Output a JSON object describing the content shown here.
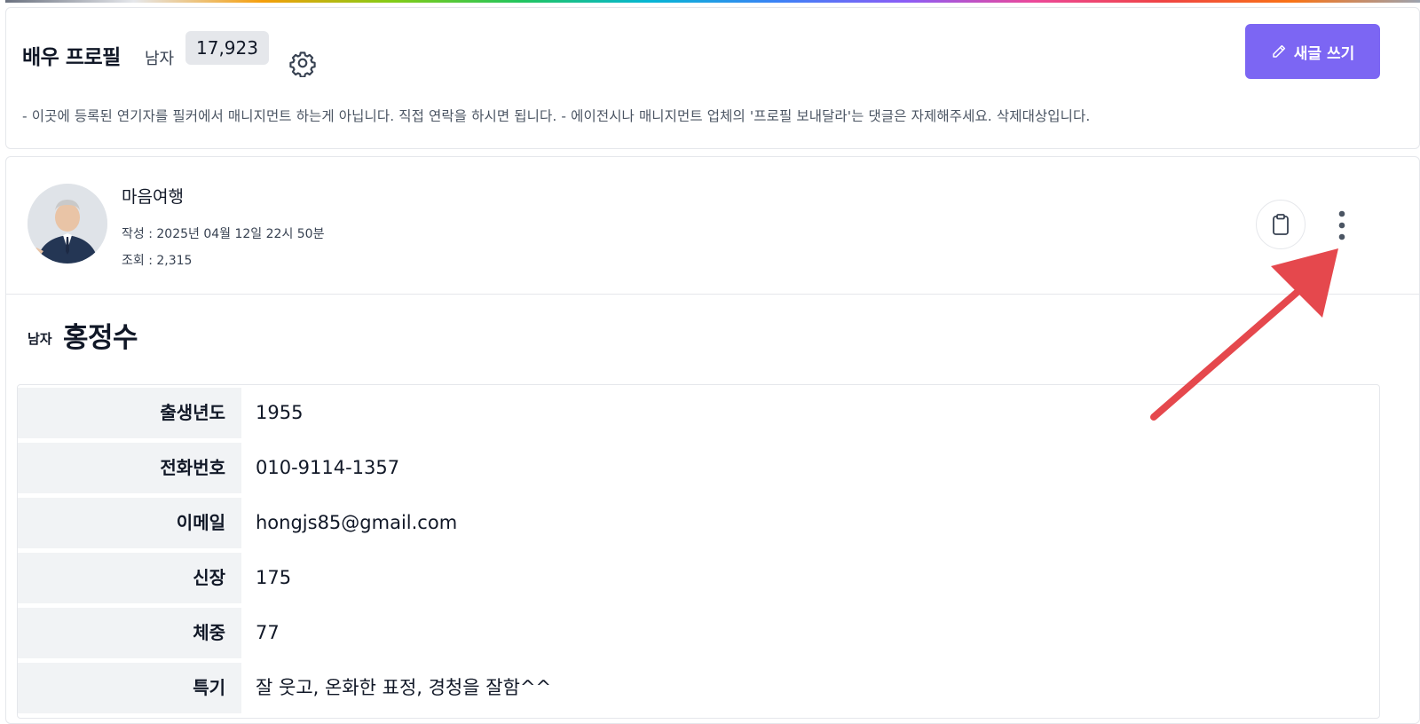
{
  "header": {
    "title": "배우 프로필",
    "subtitle": "남자",
    "count": "17,923",
    "write_button_label": "새글 쓰기",
    "notice": "- 이곳에 등록된 연기자를 필커에서 매니지먼트 하는게 아닙니다. 직접 연락을 하시면 됩니다. - 에이전시나 매니지먼트 업체의 '프로필 보내달라'는 댓글은 자제해주세요. 삭제대상입니다."
  },
  "post": {
    "author": "마음여행",
    "written": "작성 : 2025년 04월 12일 22시 50분",
    "views": "조회 : 2,315",
    "gender": "남자",
    "name": "홍정수",
    "rows": [
      {
        "label": "출생년도",
        "value": "1955"
      },
      {
        "label": "전화번호",
        "value": "010-9114-1357"
      },
      {
        "label": "이메일",
        "value": "hongjs85@gmail.com"
      },
      {
        "label": "신장",
        "value": "175"
      },
      {
        "label": "체중",
        "value": "77"
      },
      {
        "label": "특기",
        "value": "잘 웃고, 온화한 표정, 경청을 잘함^^"
      }
    ]
  },
  "icons": {
    "settings": "gear-icon",
    "write": "pencil-icon",
    "copy": "clipboard-icon",
    "more": "more-vertical-icon"
  },
  "colors": {
    "accent": "#7c66f3",
    "arrow": "#e5484d"
  }
}
